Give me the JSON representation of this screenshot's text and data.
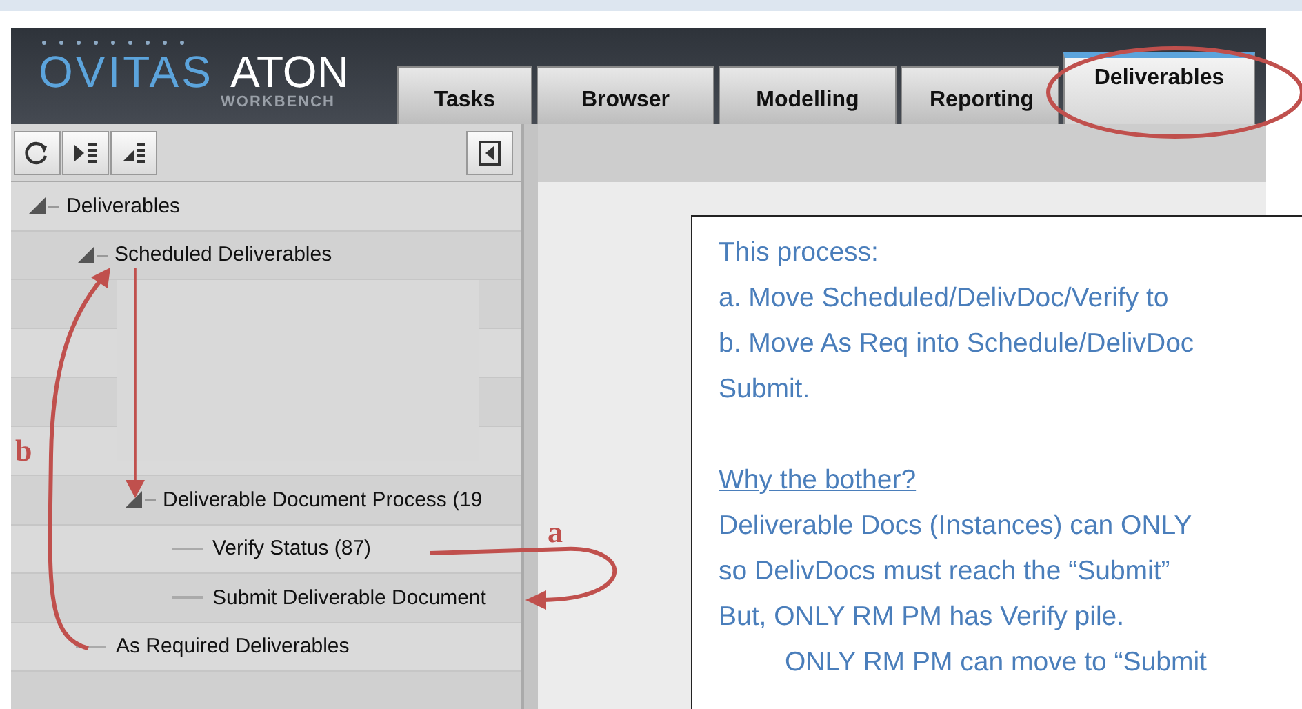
{
  "logo": {
    "brand": "OVITAS",
    "product": "ATON",
    "subtitle": "WORKBENCH"
  },
  "tabs": [
    {
      "label": "Tasks",
      "selected": false
    },
    {
      "label": "Browser",
      "selected": false
    },
    {
      "label": "Modelling",
      "selected": false
    },
    {
      "label": "Reporting",
      "selected": false
    },
    {
      "label": "Deliverables",
      "selected": true
    }
  ],
  "tree": [
    {
      "label": "Deliverables",
      "expanded": true,
      "children": [
        {
          "label": "Scheduled Deliverables",
          "expanded": true,
          "children": [
            {
              "kind": "covered"
            },
            {
              "label": "Deliverable Document Process (19",
              "expanded": true,
              "children": [
                {
                  "label": "Verify Status (87)"
                },
                {
                  "label": "Submit Deliverable Document"
                }
              ]
            }
          ]
        },
        {
          "label": "As Required Deliverables"
        }
      ]
    }
  ],
  "note": {
    "lines": [
      {
        "text": "This process:",
        "kind": "plain"
      },
      {
        "text": "a. Move Scheduled/DelivDoc/Verify to",
        "kind": "plain"
      },
      {
        "text": "b. Move As Req into Schedule/DelivDoc",
        "kind": "plain"
      },
      {
        "text": "Submit.",
        "kind": "plain"
      },
      {
        "kind": "blank"
      },
      {
        "text": "Why the bother?",
        "kind": "heading"
      },
      {
        "text": "Deliverable Docs (Instances) can ONLY",
        "kind": "plain"
      },
      {
        "text": "so DelivDocs must reach the “Submit”",
        "kind": "plain"
      },
      {
        "text": "But, ONLY RM PM has Verify pile.",
        "kind": "plain"
      },
      {
        "text": "ONLY RM PM can move to “Submit",
        "kind": "indented"
      }
    ]
  },
  "annotations": [
    {
      "label": "a"
    },
    {
      "label": "b"
    }
  ]
}
